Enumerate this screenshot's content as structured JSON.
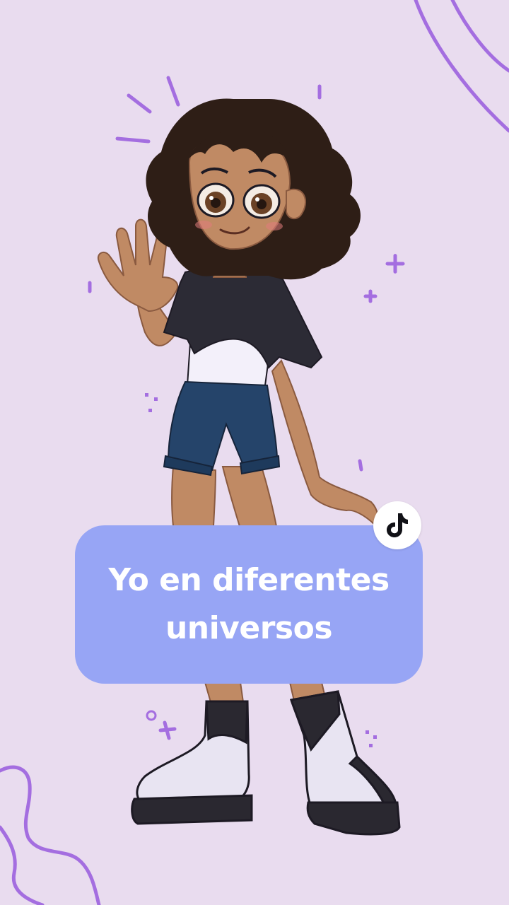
{
  "caption": {
    "line1": "Yo en diferentes",
    "line2": "universos"
  },
  "badge": {
    "icon": "tiktok-logo-icon"
  },
  "colors": {
    "background": "#e9dcef",
    "caption_card": "#97a5f5",
    "caption_text": "#ffffff",
    "accent_doodles": "#a46ee0"
  }
}
